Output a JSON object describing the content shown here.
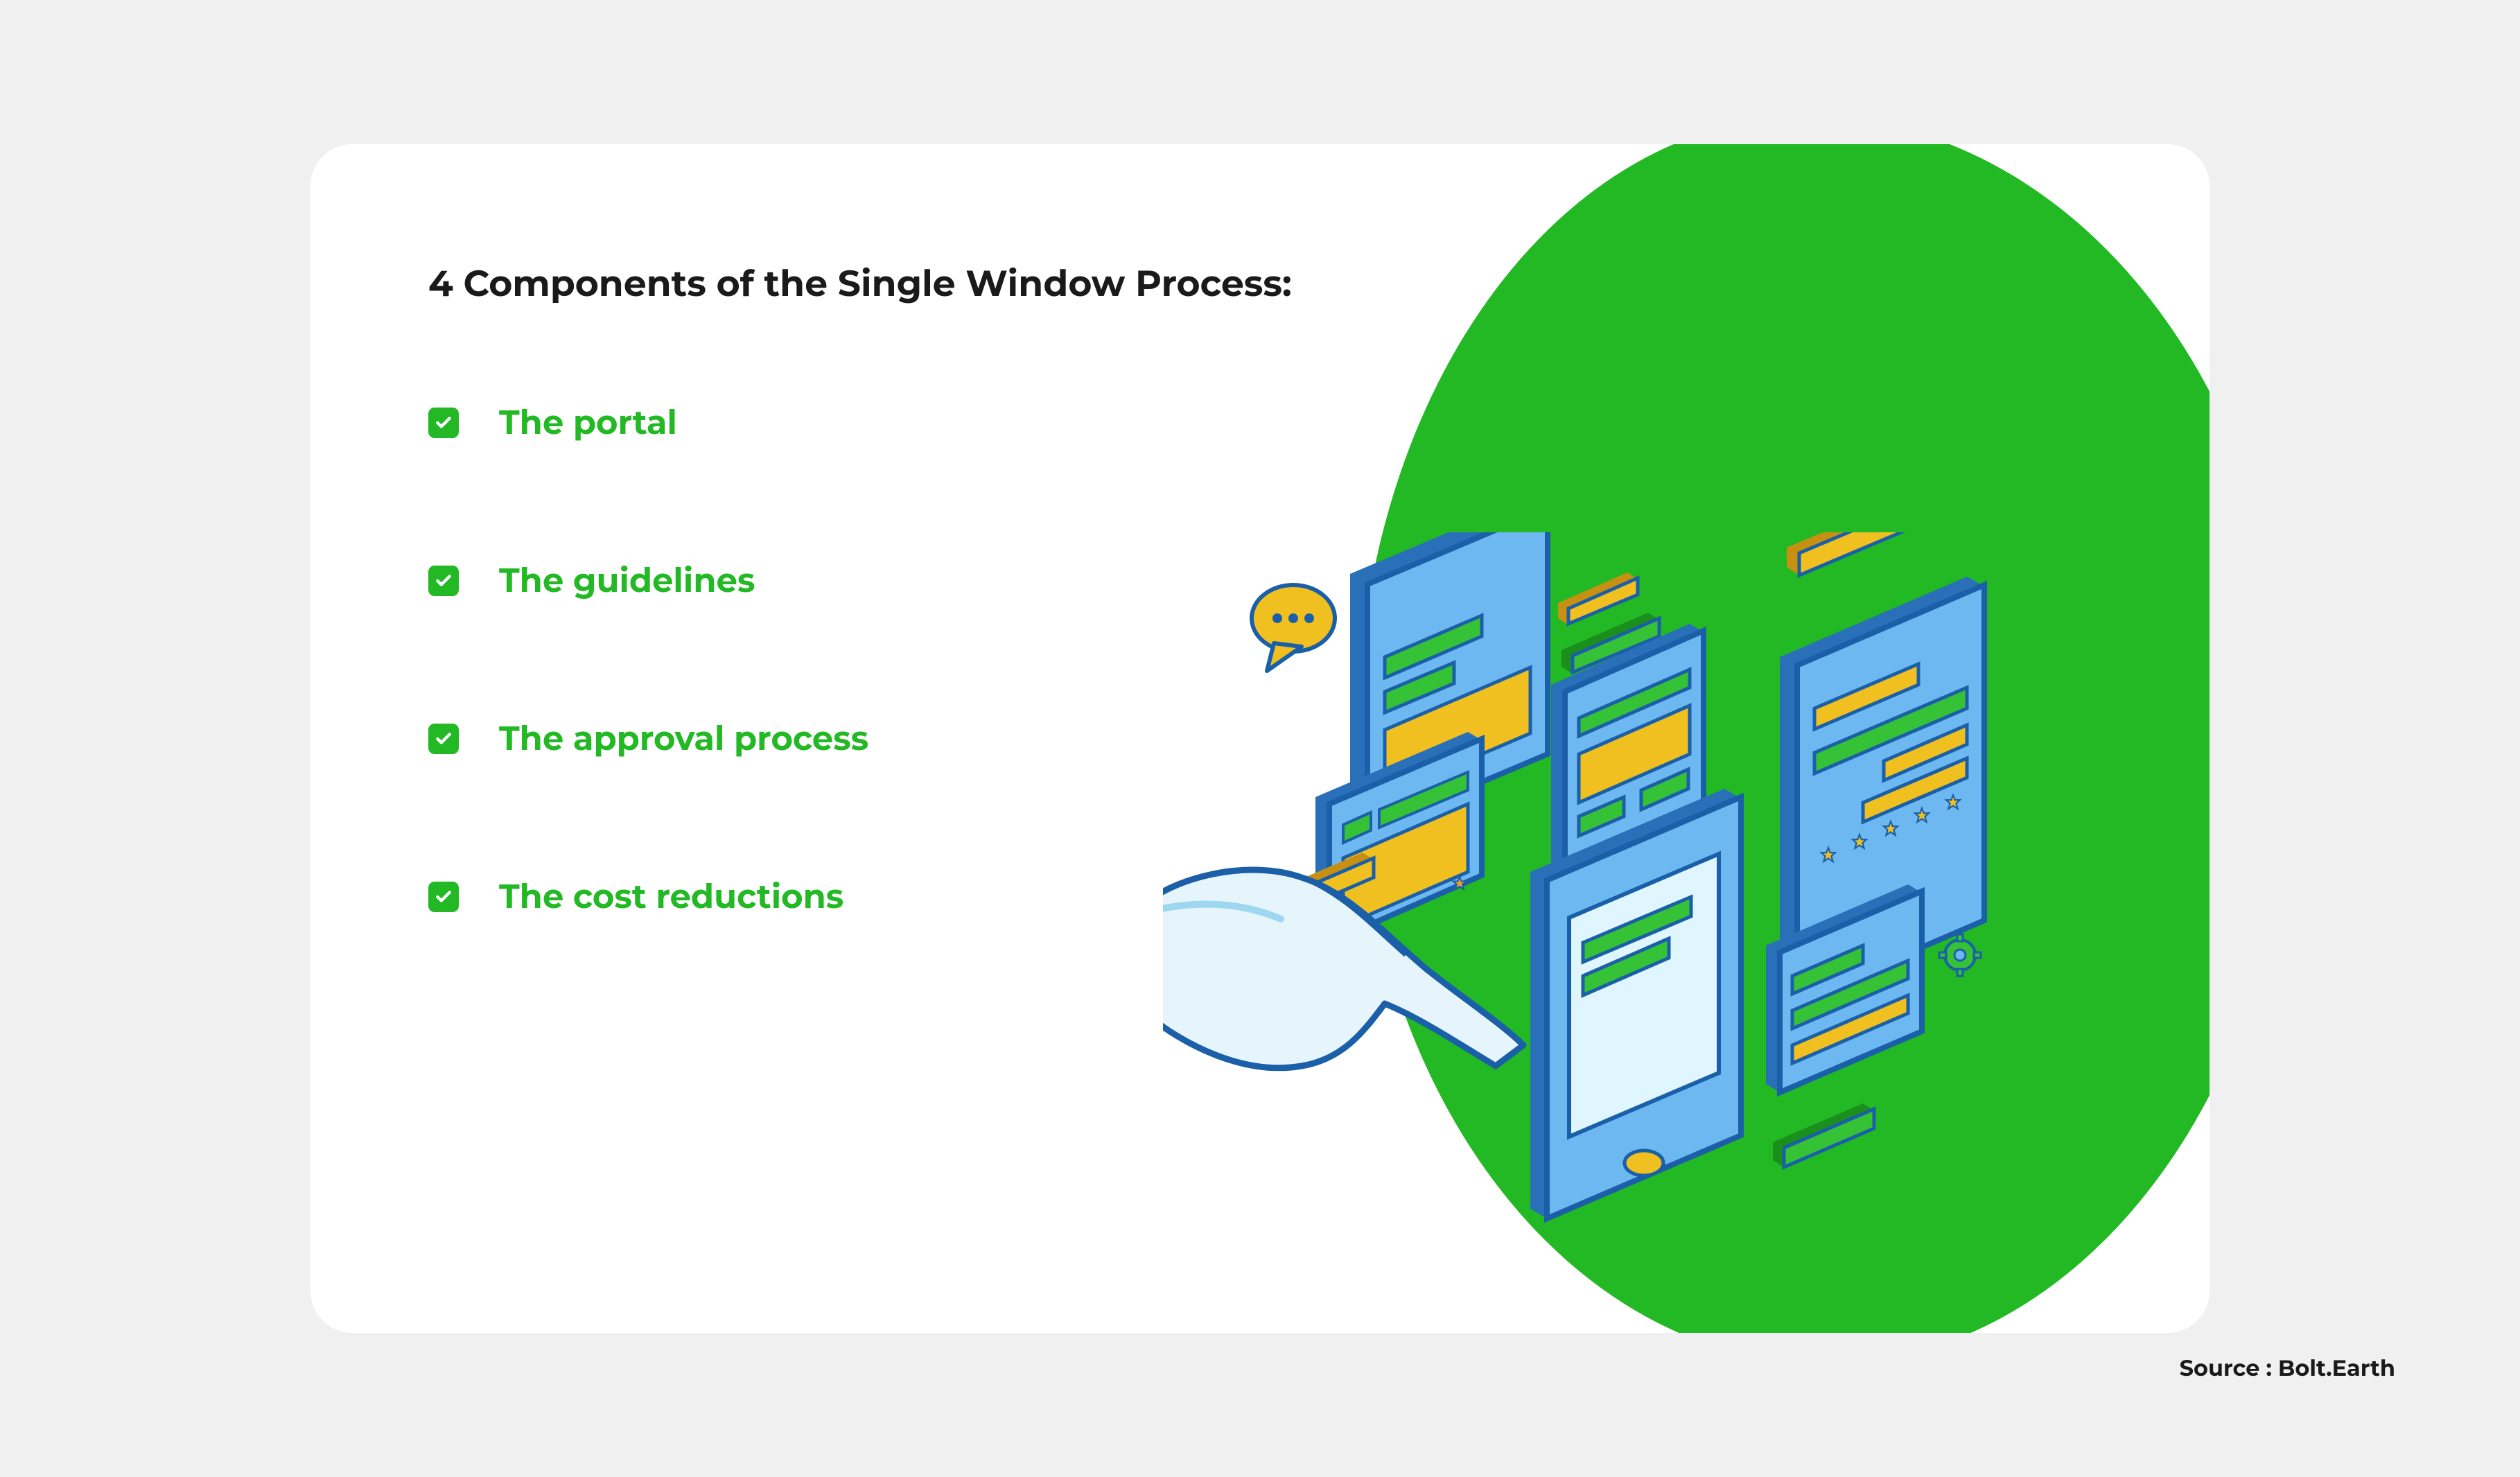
{
  "title": "4 Components of the Single Window Process:",
  "items": [
    "The portal",
    "The guidelines",
    "The approval process",
    "The cost reductions"
  ],
  "source": "Source : Bolt.Earth",
  "colors": {
    "green": "#22b924",
    "blue": "#4a9de8",
    "darkblue": "#1a5fa8",
    "yellow": "#f0c020",
    "orange": "#f0a020",
    "bg": "#f0f0f0",
    "white": "#ffffff",
    "black": "#1a1a1a"
  }
}
